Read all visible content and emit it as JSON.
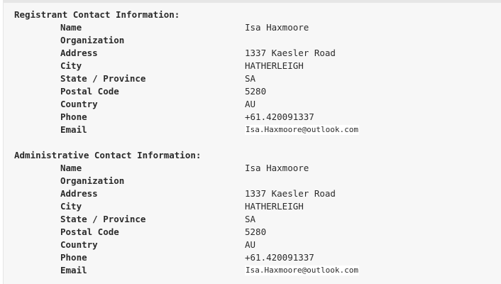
{
  "registrant": {
    "title": "Registrant Contact Information:",
    "fields": [
      {
        "label": "Name",
        "value": "Isa Haxmoore"
      },
      {
        "label": "Organization",
        "value": ""
      },
      {
        "label": "Address",
        "value": "1337 Kaesler Road"
      },
      {
        "label": "City",
        "value": "HATHERLEIGH"
      },
      {
        "label": "State / Province",
        "value": "SA"
      },
      {
        "label": "Postal Code",
        "value": "5280"
      },
      {
        "label": "Country",
        "value": "AU"
      },
      {
        "label": "Phone",
        "value": "+61.420091337"
      },
      {
        "label": "Email",
        "value": "Isa.Haxmoore@outlook.com"
      }
    ]
  },
  "administrative": {
    "title": "Administrative Contact Information:",
    "fields": [
      {
        "label": "Name",
        "value": "Isa Haxmoore"
      },
      {
        "label": "Organization",
        "value": ""
      },
      {
        "label": "Address",
        "value": "1337 Kaesler Road"
      },
      {
        "label": "City",
        "value": "HATHERLEIGH"
      },
      {
        "label": "State / Province",
        "value": "SA"
      },
      {
        "label": "Postal Code",
        "value": "5280"
      },
      {
        "label": "Country",
        "value": "AU"
      },
      {
        "label": "Phone",
        "value": "+61.420091337"
      },
      {
        "label": "Email",
        "value": "Isa.Haxmoore@outlook.com"
      }
    ]
  }
}
